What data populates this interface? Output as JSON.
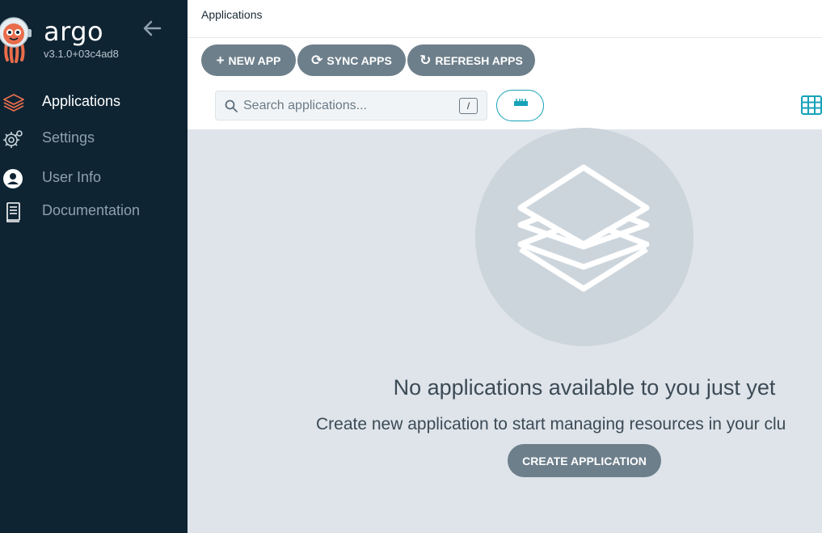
{
  "sidebar": {
    "brand": "argo",
    "version": "v3.1.0+03c4ad8",
    "items": [
      {
        "label": "Applications",
        "icon": "layers-icon",
        "active": true
      },
      {
        "label": "Settings",
        "icon": "gear-icon",
        "active": false
      },
      {
        "label": "User Info",
        "icon": "user-icon",
        "active": false
      },
      {
        "label": "Documentation",
        "icon": "book-icon",
        "active": false
      }
    ]
  },
  "header": {
    "title": "Applications"
  },
  "toolbar": {
    "new_app": "NEW APP",
    "sync_apps": "SYNC APPS",
    "refresh_apps": "REFRESH APPS",
    "search_placeholder": "Search applications...",
    "search_shortcut": "/"
  },
  "empty_state": {
    "title": "No applications available to you just yet",
    "subtitle": "Create new application to start managing resources in your clu",
    "create_button": "CREATE APPLICATION"
  },
  "colors": {
    "sidebar_bg": "#0e2433",
    "accent_orange": "#e96d4c",
    "accent_teal": "#17a2b8",
    "button_gray": "#6d7f8b",
    "content_bg": "#dee4ea"
  }
}
